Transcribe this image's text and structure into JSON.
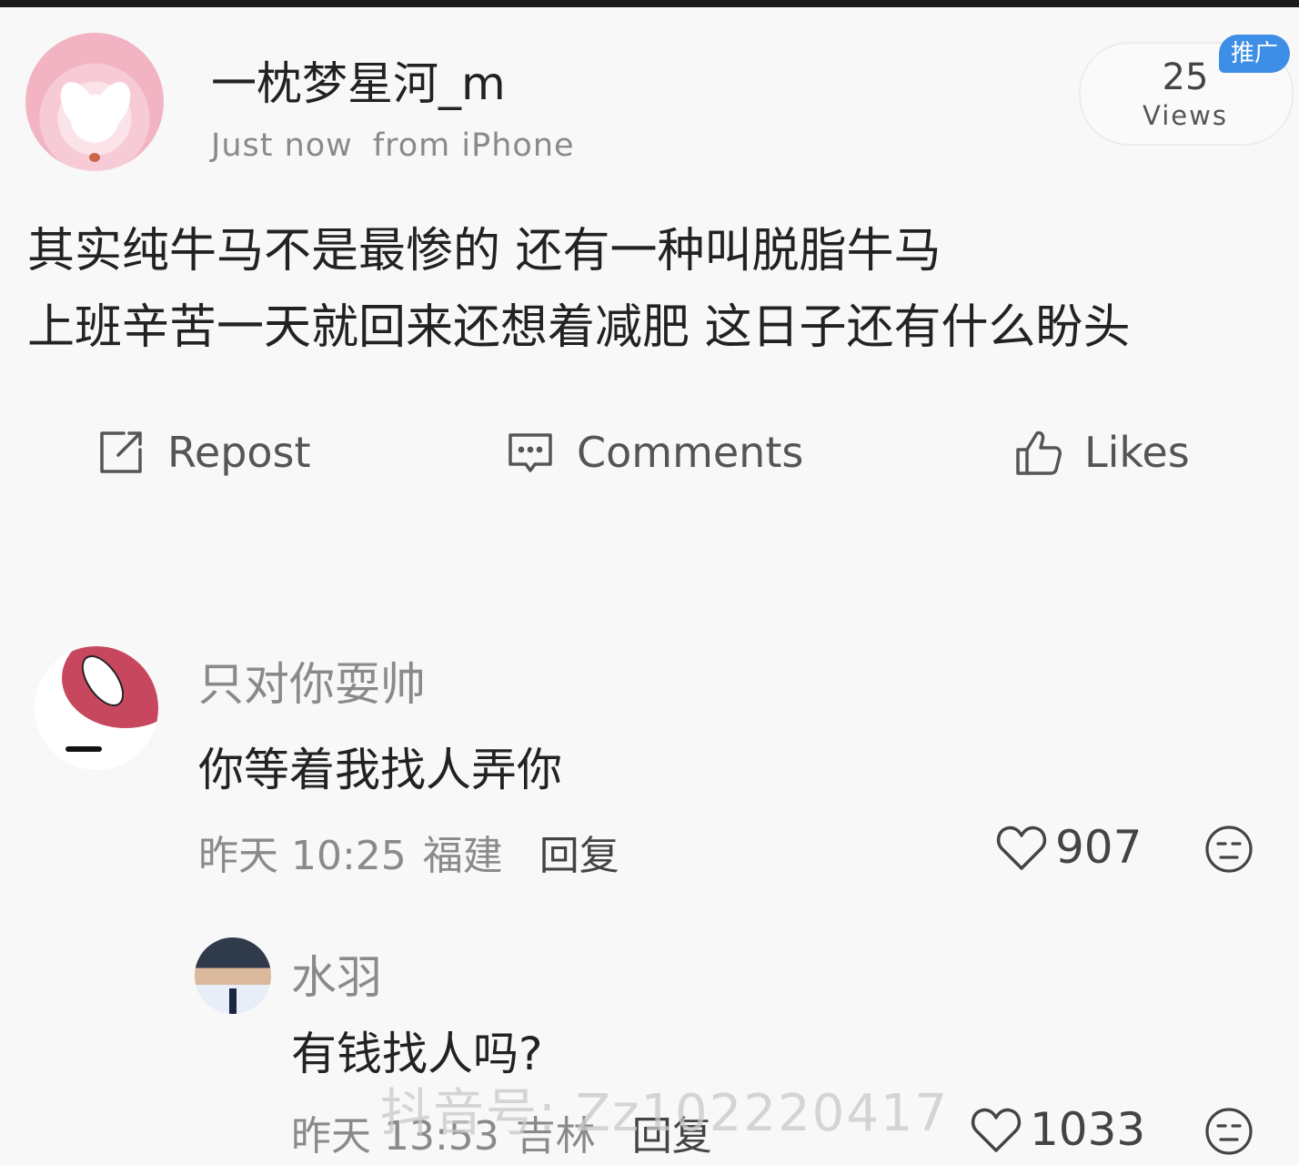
{
  "post": {
    "username": "一枕梦星河_m",
    "time": "Just now",
    "source": "from iPhone",
    "views_count": "25",
    "views_label": "Views",
    "promo_badge": "推广",
    "body_lines": [
      "其实纯牛马不是最惨的 还有一种叫脱脂牛马",
      "上班辛苦一天就回来还想着减肥 这日子还有什么盼头"
    ]
  },
  "actions": {
    "repost": "Repost",
    "comments": "Comments",
    "likes": "Likes"
  },
  "comments": [
    {
      "name": "只对你耍帅",
      "text": "你等着我找人弄你",
      "time": "昨天 10:25",
      "location": "福建",
      "reply": "回复",
      "likes": "907"
    },
    {
      "name": "水羽",
      "text": "有钱找人吗?",
      "time": "昨天 13:53",
      "location": "吉林",
      "reply": "回复",
      "likes": "1033"
    }
  ],
  "watermark": "抖音号: Zz102220417",
  "colors": {
    "background": "#f8f8f8",
    "text": "#222222",
    "muted": "#8a8a8a",
    "promo": "#3d8ee6"
  }
}
